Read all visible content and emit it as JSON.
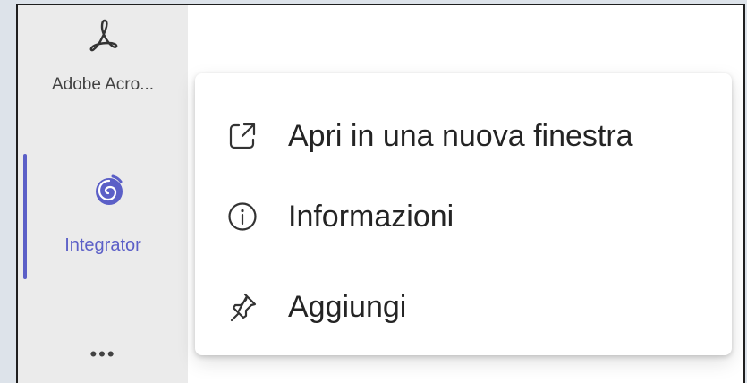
{
  "sidebar": {
    "apps": [
      {
        "label": "Adobe Acro...",
        "icon": "adobe-acrobat-icon"
      },
      {
        "label": "Integrator",
        "icon": "integrator-swirl-icon",
        "active": true
      }
    ],
    "more_label": "•••"
  },
  "context_menu": {
    "items": [
      {
        "label": "Apri in una nuova finestra",
        "icon": "open-in-new-window-icon"
      },
      {
        "label": "Informazioni",
        "icon": "info-icon"
      },
      {
        "label": "Aggiungi",
        "icon": "pin-icon",
        "highlighted": true
      }
    ]
  },
  "colors": {
    "accent": "#5b5fc7",
    "highlight": "#f8ff3c",
    "rail": "#ebebeb",
    "text": "#242424"
  }
}
